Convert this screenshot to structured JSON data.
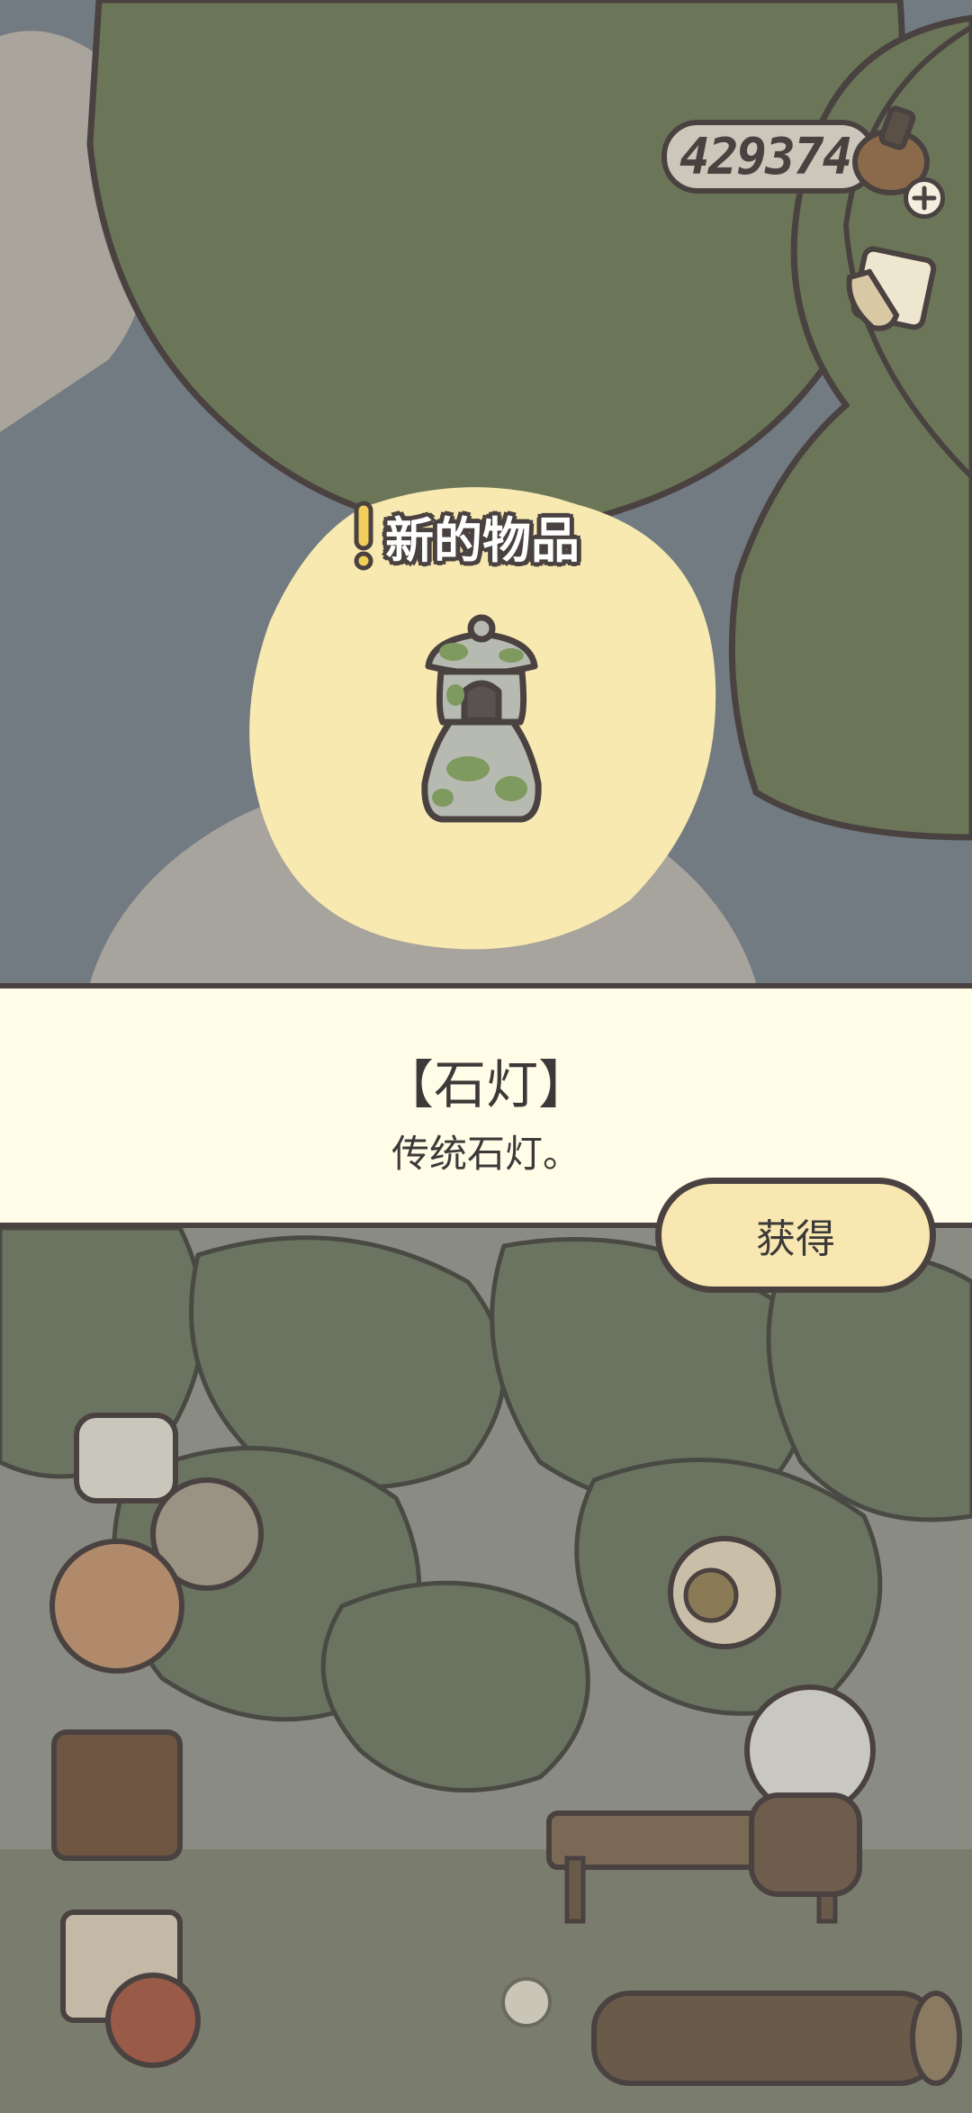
{
  "hud": {
    "currency_value": "429374",
    "currency_icon": "clover-pot-icon",
    "add_icon": "plus-icon",
    "menu_icon": "scroll-note-icon"
  },
  "notice": {
    "label": "新的物品",
    "icon": "exclamation-icon"
  },
  "item": {
    "icon": "stone-lantern-icon",
    "name": "【石灯】",
    "description": "传统石灯。"
  },
  "actions": {
    "obtain_label": "获得"
  },
  "colors": {
    "panel_bg": "#fffce8",
    "button_bg": "#f9e7b1",
    "outline": "#4a4240",
    "highlight": "#f7e9b0",
    "foliage": "#6b7658"
  }
}
